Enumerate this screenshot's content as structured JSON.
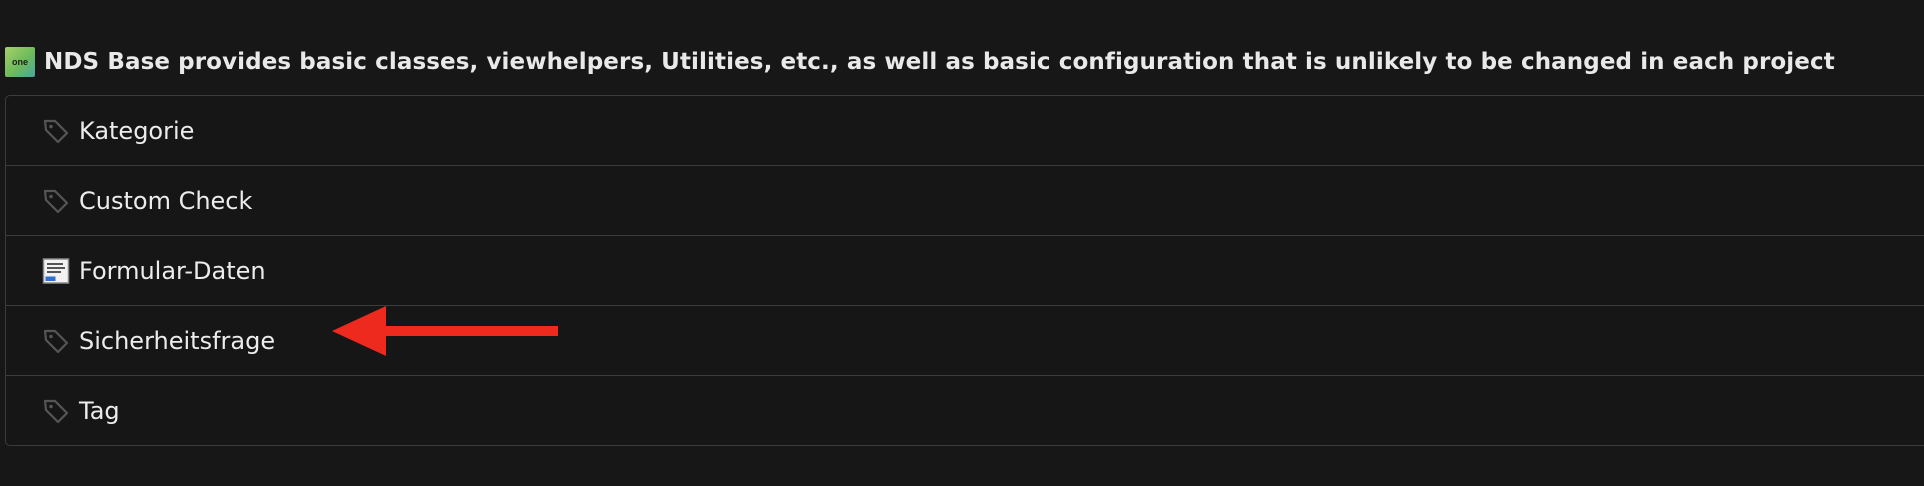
{
  "header": {
    "icon_text": "one",
    "icon_name": "extension-icon",
    "title": "NDS Base provides basic classes, viewhelpers, Utilities, etc., as well as basic configuration that is unlikely to be changed in each project"
  },
  "records": [
    {
      "label": "Kategorie",
      "icon": "tag-icon"
    },
    {
      "label": "Custom Check",
      "icon": "tag-icon"
    },
    {
      "label": "Formular-Daten",
      "icon": "form-data-icon"
    },
    {
      "label": "Sicherheitsfrage",
      "icon": "tag-icon"
    },
    {
      "label": "Tag",
      "icon": "tag-icon"
    }
  ],
  "annotation": {
    "arrow_color": "#ee2a1e",
    "points_to": "Sicherheitsfrage"
  },
  "colors": {
    "background": "#171717",
    "border": "#3c3c3c",
    "text": "#ececec",
    "tag_icon": "#555555"
  }
}
